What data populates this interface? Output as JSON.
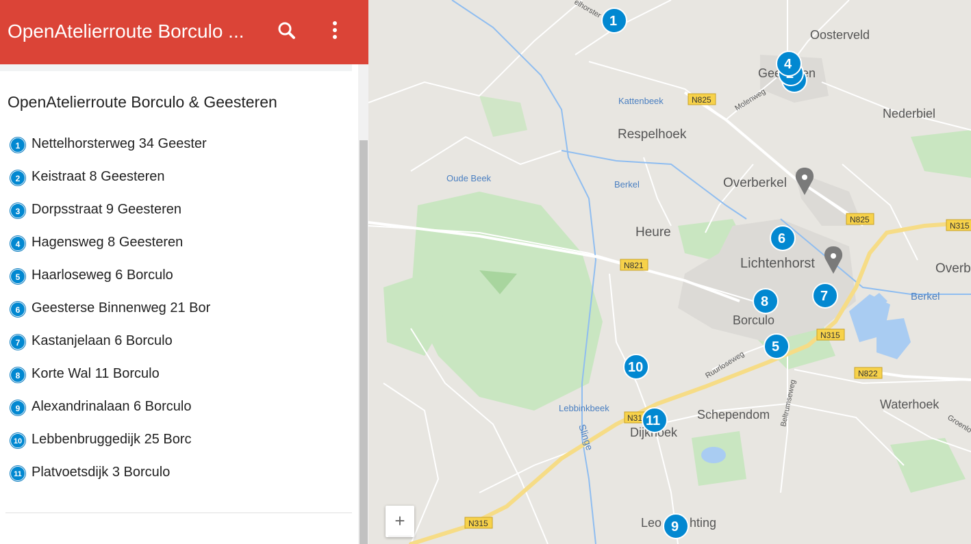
{
  "header": {
    "title": "OpenAtelierroute Borculo ...",
    "search_icon": "search-icon",
    "menu_icon": "more-vert-icon",
    "color": "#db4437"
  },
  "layer": {
    "title": "OpenAtelierroute Borculo & Geesteren",
    "items": [
      {
        "num": "1",
        "label": "Nettelhorsterweg 34 Geester"
      },
      {
        "num": "2",
        "label": "Keistraat 8 Geesteren"
      },
      {
        "num": "3",
        "label": "Dorpsstraat 9 Geesteren"
      },
      {
        "num": "4",
        "label": "Hagensweg 8 Geesteren"
      },
      {
        "num": "5",
        "label": "Haarloseweg 6 Borculo"
      },
      {
        "num": "6",
        "label": "Geesterse Binnenweg 21 Bor"
      },
      {
        "num": "7",
        "label": "Kastanjelaan 6 Borculo"
      },
      {
        "num": "8",
        "label": "Korte Wal 11 Borculo"
      },
      {
        "num": "9",
        "label": "Alexandrinalaan 6 Borculo"
      },
      {
        "num": "10",
        "label": "Lebbenbruggedijk 25 Borc"
      },
      {
        "num": "11",
        "label": "Platvoetsdijk 3 Borculo"
      }
    ],
    "marker_color": "#0288d1"
  },
  "map": {
    "places": {
      "oosterveld": "Oosterveld",
      "geesteren": "Geesteren",
      "nederbiel": "Nederbiel",
      "respelhoek": "Respelhoek",
      "overberkel": "Overberkel",
      "heure": "Heure",
      "lichtenhorst": "Lichtenhorst",
      "overb": "Overb",
      "borculo": "Borculo",
      "schependom": "Schependom",
      "waterhoek": "Waterhoek",
      "dijkhoek": "Dijkhoek",
      "leo": "Leo",
      "hting": "hting"
    },
    "water": {
      "kattenbeek": "Kattenbeek",
      "oude_beek": "Oude Beek",
      "berkel_w": "Berkel",
      "berkel_e": "Berkel",
      "lebbinkbeek": "Lebbinkbeek",
      "slinge": "Slinge"
    },
    "streets": {
      "molenweg": "Molenweg",
      "ruurloseweg": "Ruurloseweg",
      "beltrumseweg": "Beltrumseweg",
      "nettelhorster": "elhorster",
      "groenlo": "Groenlo"
    },
    "shields": {
      "n825_a": "N825",
      "n825_b": "N825",
      "n315_a": "N315",
      "n315_b": "N315",
      "n315_c": "N315",
      "n31": "N31",
      "n821": "N821",
      "n822": "N822"
    },
    "zoom_in": "+"
  }
}
